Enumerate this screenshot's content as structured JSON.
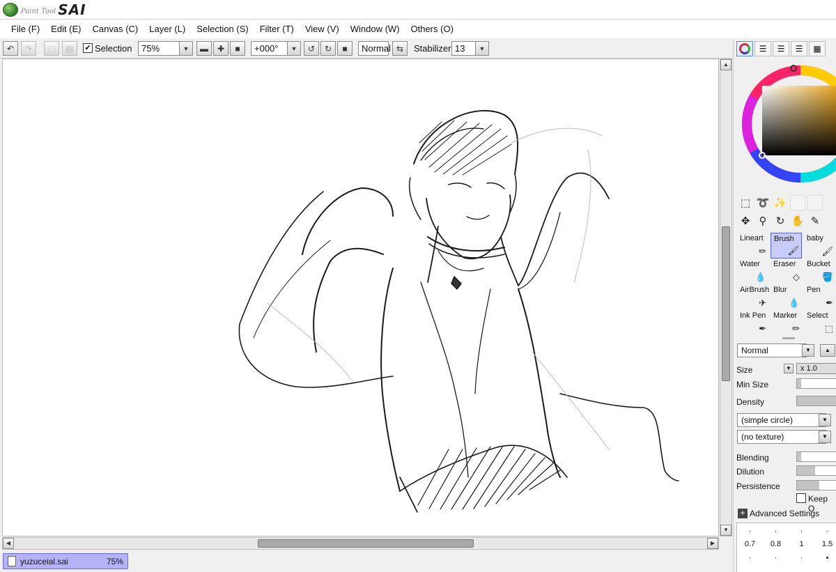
{
  "app": {
    "logo_small": "Paint Tool",
    "logo_big": "SAI"
  },
  "menu": [
    {
      "label": "File (F)"
    },
    {
      "label": "Edit (E)"
    },
    {
      "label": "Canvas (C)"
    },
    {
      "label": "Layer (L)"
    },
    {
      "label": "Selection (S)"
    },
    {
      "label": "Filter (T)"
    },
    {
      "label": "View (V)"
    },
    {
      "label": "Window (W)"
    },
    {
      "label": "Others (O)"
    }
  ],
  "toolbar": {
    "selection_label": "Selection",
    "selection_checked": true,
    "zoom_value": "75%",
    "rotation_value": "+000°",
    "blend_mode": "Normal",
    "stabilizer_label": "Stabilizer",
    "stabilizer_value": "13"
  },
  "document": {
    "tab_name": "yuzuceial.sai",
    "tab_zoom": "75%"
  },
  "colors": {
    "selected_tab": "#b3b3f6",
    "selected_brush": "#c8cdf8",
    "accent": "#5a63d8"
  },
  "tools": {
    "brushes": [
      {
        "label": "Lineart",
        "icon": "pencil-icon"
      },
      {
        "label": "Brush",
        "icon": "brush-icon",
        "selected": true
      },
      {
        "label": "baby",
        "icon": "brush-icon"
      },
      {
        "label": "Water",
        "icon": "water-brush-icon"
      },
      {
        "label": "Eraser",
        "icon": "eraser-icon"
      },
      {
        "label": "Bucket",
        "icon": "bucket-icon"
      },
      {
        "label": "AirBrush",
        "icon": "airbrush-icon"
      },
      {
        "label": "Blur",
        "icon": "blur-icon"
      },
      {
        "label": "Pen",
        "icon": "pen-icon"
      },
      {
        "label": "Ink Pen",
        "icon": "ink-pen-icon"
      },
      {
        "label": "Marker",
        "icon": "marker-icon"
      },
      {
        "label": "Select",
        "icon": "select-brush-icon"
      }
    ]
  },
  "brush_settings": {
    "mode": "Normal",
    "size_label": "Size",
    "size_multiplier": "x 1.0",
    "min_size_label": "Min Size",
    "density_label": "Density",
    "shape": "(simple circle)",
    "texture": "(no texture)",
    "blending_label": "Blending",
    "dilution_label": "Dilution",
    "persistence_label": "Persistence",
    "keep_opacity_label": "Keep O",
    "advanced_label": "Advanced Settings",
    "min_size_level": 0.1,
    "density_level": 1.0,
    "blending_level": 0.1,
    "dilution_level": 0.45,
    "persistence_level": 0.55
  },
  "size_presets": [
    "0.7",
    "0.8",
    "1",
    "1.5"
  ]
}
